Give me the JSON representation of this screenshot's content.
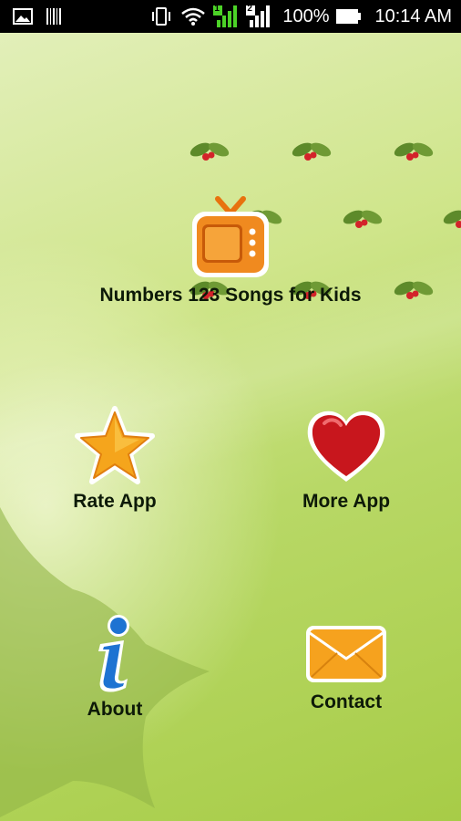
{
  "status_bar": {
    "battery_percent": "100%",
    "time": "10:14 AM",
    "sim1_label": "1",
    "sim2_label": "2",
    "icons": [
      "image-icon",
      "barcode-icon",
      "vibrate-icon",
      "wifi-icon",
      "signal-sim1-icon",
      "signal-sim2-icon",
      "battery-icon"
    ]
  },
  "menu": {
    "title_button": {
      "label": "Numbers 123 Songs for Kids",
      "icon": "tv-icon"
    },
    "rate_button": {
      "label": "Rate App",
      "icon": "star-icon"
    },
    "more_button": {
      "label": "More App",
      "icon": "heart-icon"
    },
    "about_button": {
      "label": "About",
      "icon": "info-icon"
    },
    "contact_button": {
      "label": "Contact",
      "icon": "envelope-icon"
    }
  },
  "colors": {
    "accent_orange": "#f28b1e",
    "heart_red": "#c8161d",
    "info_blue": "#1e73d2",
    "envelope_orange": "#f6a21e",
    "background_green": "#b8d866"
  }
}
